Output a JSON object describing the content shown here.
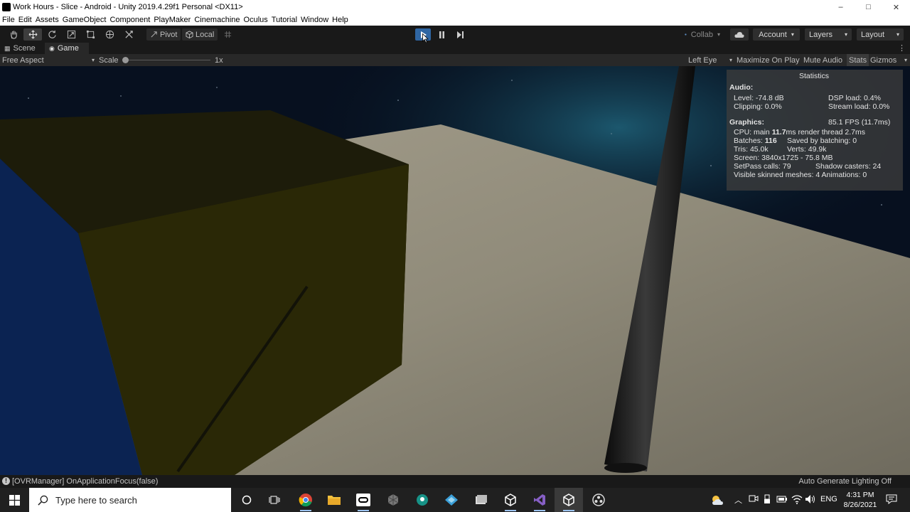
{
  "window": {
    "title": "Work Hours - Slice - Android - Unity 2019.4.29f1 Personal <DX11>",
    "minimize": "–",
    "maximize": "□",
    "close": "✕"
  },
  "menu": [
    "File",
    "Edit",
    "Assets",
    "GameObject",
    "Component",
    "PlayMaker",
    "Cinemachine",
    "Oculus",
    "Tutorial",
    "Window",
    "Help"
  ],
  "toolbar": {
    "tools": [
      "hand-tool-icon",
      "move-tool-icon",
      "rotate-tool-icon",
      "scale-tool-icon",
      "rect-tool-icon",
      "transform-tool-icon",
      "custom-tool-icon"
    ],
    "pivot_label": "Pivot",
    "local_label": "Local",
    "collab_label": "Collab",
    "account_label": "Account",
    "layers_label": "Layers",
    "layout_label": "Layout",
    "play_color": "#2f66a3"
  },
  "tabs": {
    "scene": "Scene",
    "game": "Game"
  },
  "gamebar": {
    "aspect": "Free Aspect",
    "scale_label": "Scale",
    "scale_value": "1x",
    "scale_fraction": 0.0,
    "eye": "Left Eye",
    "maximize": "Maximize On Play",
    "mute": "Mute Audio",
    "stats": "Stats",
    "gizmos": "Gizmos"
  },
  "stats": {
    "title": "Statistics",
    "audio_header": "Audio:",
    "level": "Level: -74.8 dB",
    "dsp": "DSP load: 0.4%",
    "clipping": "Clipping: 0.0%",
    "stream": "Stream load: 0.0%",
    "graphics_header": "Graphics:",
    "fps": "85.1 FPS (11.7ms)",
    "cpu_prefix": "CPU: main ",
    "cpu_main": "11.7",
    "cpu_suffix": "ms  render thread 2.7ms",
    "batches_prefix": "Batches: ",
    "batches": "116",
    "saved": "Saved by batching: 0",
    "tris": "Tris: 45.0k",
    "verts": "Verts: 49.9k",
    "screen": "Screen: 3840x1725 - 75.8 MB",
    "setpass": "SetPass calls: 79",
    "shadow": "Shadow casters: 24",
    "skinned": "Visible skinned meshes: 4  Animations: 0"
  },
  "status": {
    "message": "[OVRManager] OnApplicationFocus(false)",
    "lighting": "Auto Generate Lighting Off"
  },
  "taskbar": {
    "search_placeholder": "Type here to search",
    "apps": [
      "cortana-icon",
      "task-view-icon",
      "chrome-icon",
      "file-explorer-icon",
      "oculus-icon",
      "unity-hub-icon",
      "gitkraken-icon",
      "blender-icon",
      "files-icon",
      "unity-icon",
      "visual-studio-icon",
      "unity-editor-icon",
      "obs-icon"
    ],
    "language": "ENG",
    "time": "4:31 PM",
    "date": "8/26/2021"
  }
}
